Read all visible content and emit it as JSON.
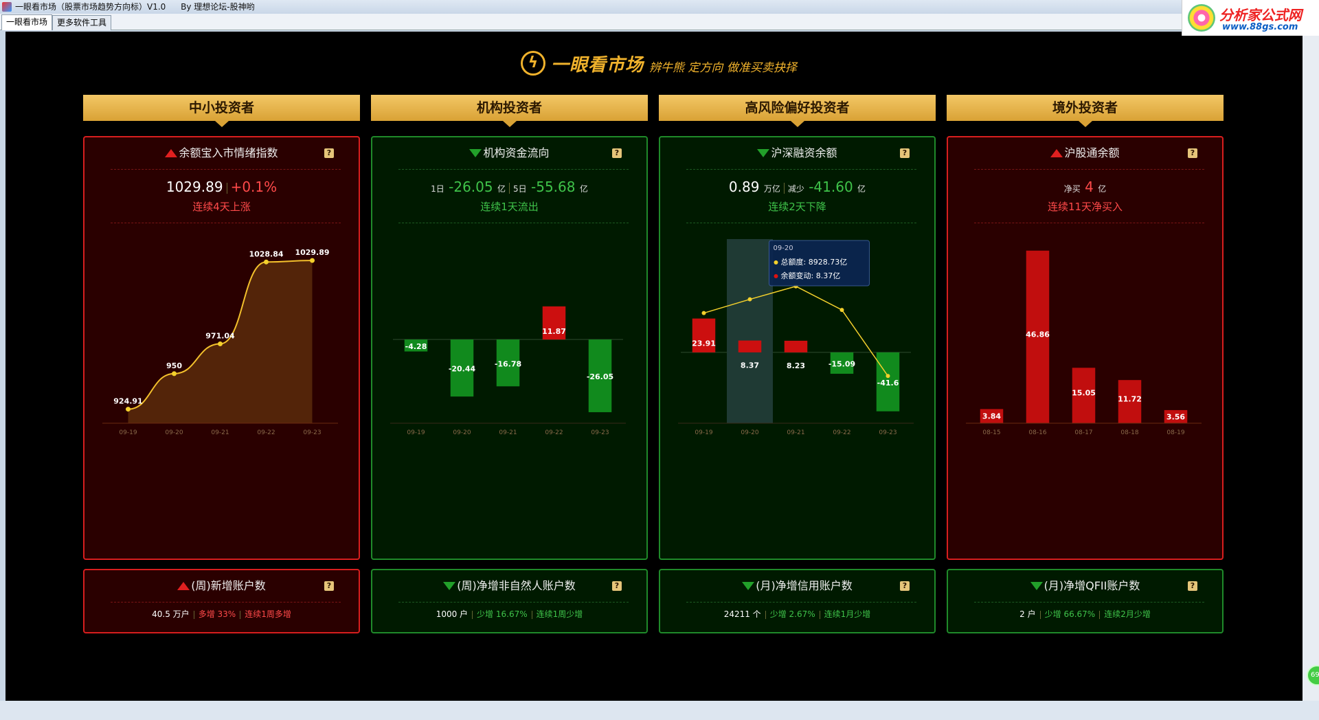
{
  "window": {
    "title": "一眼看市场（股票市场趋势方向标）V1.0",
    "author": "By 理想论坛-股神哟"
  },
  "watermark": {
    "brand": "分析家公式网",
    "url": "www.88gs.com"
  },
  "tabs": [
    {
      "label": "一眼看市场",
      "active": true
    },
    {
      "label": "更多软件工具",
      "active": false
    }
  ],
  "logo": {
    "name": "一眼看市场",
    "slogan": "辨牛熊 定方向 做准买卖抉择"
  },
  "corner_badge": "69",
  "colors": {
    "gold": "#f0b22c",
    "up_red": "#ff4a4a",
    "down_green": "#3fc34a"
  },
  "columns": [
    {
      "header": "中小投资者",
      "main": {
        "title": "余额宝入市情绪指数",
        "direction": "up",
        "value": "1029.89",
        "change": "+0.1%",
        "streak": "连续4天上涨"
      },
      "small": {
        "title": "(周)新增账户数",
        "direction": "up",
        "value": "40.5 万户",
        "label": "多增",
        "pct": "33%",
        "streak": "连续1周多增"
      }
    },
    {
      "header": "机构投资者",
      "main": {
        "title": "机构资金流向",
        "direction": "down",
        "d1_label": "1日",
        "d1_value": "-26.05",
        "d5_label": "5日",
        "d5_value": "-55.68",
        "unit": "亿",
        "streak": "连续1天流出"
      },
      "small": {
        "title": "(周)净增非自然人账户数",
        "direction": "down",
        "value": "1000 户",
        "label": "少增",
        "pct": "16.67%",
        "streak": "连续1周少增"
      }
    },
    {
      "header": "高风险偏好投资者",
      "main": {
        "title": "沪深融资余额",
        "direction": "down",
        "value": "0.89",
        "value_unit": "万亿",
        "change_label": "减少",
        "change": "-41.60",
        "change_unit": "亿",
        "streak": "连续2天下降"
      },
      "small": {
        "title": "(月)净增信用账户数",
        "direction": "down",
        "value": "24211 个",
        "label": "少增",
        "pct": "2.67%",
        "streak": "连续1月少增"
      }
    },
    {
      "header": "境外投资者",
      "main": {
        "title": "沪股通余额",
        "direction": "up",
        "net_label": "净买",
        "net_value": "4",
        "net_unit": "亿",
        "streak": "连续11天净买入"
      },
      "small": {
        "title": "(月)净增QFII账户数",
        "direction": "down",
        "value": "2 户",
        "label": "少增",
        "pct": "66.67%",
        "streak": "连续2月少增"
      }
    }
  ],
  "chart_data": [
    {
      "type": "area",
      "x": [
        "09-19",
        "09-20",
        "09-21",
        "09-22",
        "09-23"
      ],
      "values": [
        924.91,
        950,
        971.04,
        1028.84,
        1029.89
      ],
      "ylim": [
        915,
        1045
      ]
    },
    {
      "type": "bar",
      "categories": [
        "09-19",
        "09-20",
        "09-21",
        "09-22",
        "09-23"
      ],
      "values": [
        -4.28,
        -20.44,
        -16.78,
        11.87,
        -26.05
      ],
      "ylim": [
        -30,
        36
      ]
    },
    {
      "type": "bar",
      "categories": [
        "09-19",
        "09-20",
        "09-21",
        "09-22",
        "09-23"
      ],
      "values": [
        23.91,
        8.37,
        8.23,
        -15.09,
        -41.6
      ],
      "line_series": [
        8920,
        8928.73,
        8937,
        8922,
        8880
      ],
      "ylim": [
        -50,
        80
      ],
      "tooltip": {
        "date": "09-20",
        "total_label": "总额度:",
        "total_value": "8928.73亿",
        "change_label": "余额变动:",
        "change_value": "8.37亿"
      }
    },
    {
      "type": "bar",
      "categories": [
        "08-15",
        "08-16",
        "08-17",
        "08-18",
        "08-19"
      ],
      "values": [
        3.84,
        46.86,
        15.05,
        11.72,
        3.56
      ],
      "ylim": [
        0,
        50
      ]
    }
  ]
}
